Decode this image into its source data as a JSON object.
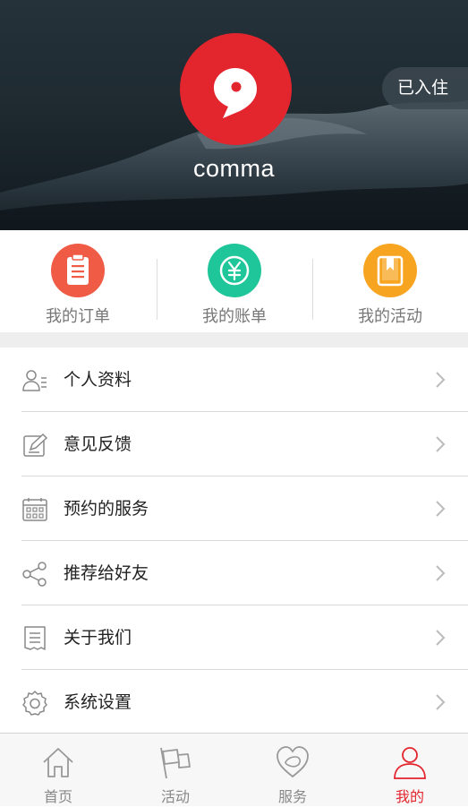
{
  "header": {
    "username": "comma",
    "status": "已入住",
    "avatar_icon": "chat-bubble-logo-icon",
    "colors": {
      "avatar_bg": "#e3252e",
      "header_bg": "#1f2a31"
    }
  },
  "quick_actions": [
    {
      "label": "我的订单",
      "icon": "clipboard-icon",
      "color": "#f05b45"
    },
    {
      "label": "我的账单",
      "icon": "yen-icon",
      "color": "#1fc69a"
    },
    {
      "label": "我的活动",
      "icon": "bookmark-book-icon",
      "color": "#f7a521"
    }
  ],
  "menu": [
    {
      "label": "个人资料",
      "icon": "profile-icon"
    },
    {
      "label": "意见反馈",
      "icon": "edit-note-icon"
    },
    {
      "label": "预约的服务",
      "icon": "calendar-icon"
    },
    {
      "label": "推荐给好友",
      "icon": "share-icon"
    },
    {
      "label": "关于我们",
      "icon": "document-icon"
    },
    {
      "label": "系统设置",
      "icon": "gear-icon"
    }
  ],
  "tabbar": {
    "active_color": "#e3252e",
    "tabs": [
      {
        "label": "首页",
        "icon": "home-icon",
        "active": false
      },
      {
        "label": "活动",
        "icon": "flag-icon",
        "active": false
      },
      {
        "label": "服务",
        "icon": "heart-icon",
        "active": false
      },
      {
        "label": "我的",
        "icon": "user-icon",
        "active": true
      }
    ]
  }
}
